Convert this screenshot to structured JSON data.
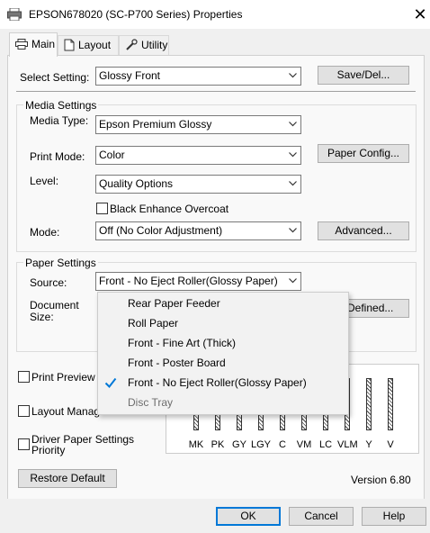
{
  "window": {
    "title": "EPSON678020 (SC-P700 Series) Properties",
    "close_glyph": "✕"
  },
  "tabs": [
    {
      "label": "Main",
      "icon": "printer-icon"
    },
    {
      "label": "Layout",
      "icon": "page-icon"
    },
    {
      "label": "Utility",
      "icon": "wrench-icon"
    }
  ],
  "select_setting": {
    "label": "Select Setting:",
    "value": "Glossy Front",
    "button": "Save/Del..."
  },
  "media_settings": {
    "group_label": "Media Settings",
    "media_type_label": "Media Type:",
    "media_type_value": "Epson Premium Glossy",
    "print_mode_label": "Print Mode:",
    "print_mode_value": "Color",
    "paper_config_button": "Paper Config...",
    "level_label": "Level:",
    "level_value": "Quality Options",
    "black_enhance_label": "Black Enhance Overcoat",
    "black_enhance_checked": false,
    "mode_label": "Mode:",
    "mode_value": "Off (No Color Adjustment)",
    "advanced_button": "Advanced..."
  },
  "paper_settings": {
    "group_label": "Paper Settings",
    "source_label": "Source:",
    "source_value": "Front - No Eject Roller(Glossy Paper)",
    "document_label_1": "Document",
    "document_label_2": "Size:",
    "user_defined_button": "Defined..."
  },
  "source_dropdown": {
    "items": [
      {
        "label": "Rear Paper Feeder",
        "checked": false,
        "disabled": false
      },
      {
        "label": "Roll Paper",
        "checked": false,
        "disabled": false
      },
      {
        "label": "Front - Fine Art (Thick)",
        "checked": false,
        "disabled": false
      },
      {
        "label": "Front - Poster Board",
        "checked": false,
        "disabled": false
      },
      {
        "label": "Front - No Eject Roller(Glossy Paper)",
        "checked": true,
        "disabled": false
      },
      {
        "label": "Disc Tray",
        "checked": false,
        "disabled": true
      }
    ]
  },
  "options": {
    "print_preview_label": "Print Preview",
    "layout_manager_label": "Layout Manage",
    "driver_paper_line1": "Driver Paper Settings",
    "driver_paper_line2": "Priority"
  },
  "ink_levels": {
    "labels": [
      "MK",
      "PK",
      "GY",
      "LGY",
      "C",
      "VM",
      "LC",
      "VLM",
      "Y",
      "V"
    ]
  },
  "footer": {
    "restore_button": "Restore Default",
    "version": "Version 6.80",
    "ok_button": "OK",
    "cancel_button": "Cancel",
    "help_button": "Help"
  },
  "colors": {
    "accent": "#0078d7",
    "check": "#0078d7"
  }
}
